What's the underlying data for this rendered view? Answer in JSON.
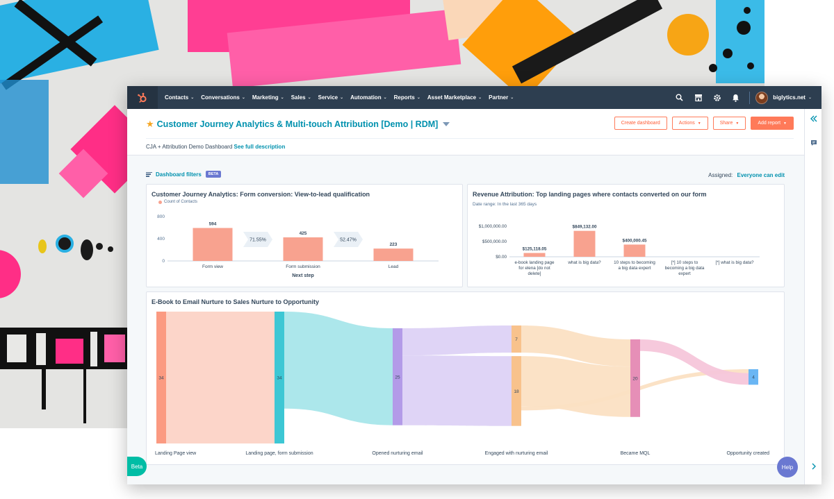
{
  "nav": {
    "items": [
      "Contacts",
      "Conversations",
      "Marketing",
      "Sales",
      "Service",
      "Automation",
      "Reports",
      "Asset Marketplace",
      "Partner"
    ],
    "account": "biglytics.net",
    "icons": [
      "search-icon",
      "marketplace-icon",
      "settings-icon",
      "notifications-icon"
    ]
  },
  "header": {
    "title": "Customer Journey Analytics & Multi-touch Attribution [Demo | RDM]",
    "create_label": "Create dashboard",
    "actions_label": "Actions",
    "share_label": "Share",
    "add_report_label": "Add report",
    "description": "CJA + Attribution Demo Dashboard",
    "see_full": "See full description"
  },
  "filters": {
    "label": "Dashboard filters",
    "badge": "BETA",
    "assigned_label": "Assigned:",
    "assigned_value": "Everyone can edit"
  },
  "report1": {
    "title": "Customer Journey Analytics: Form conversion: View-to-lead qualification",
    "legend": "Count of Contacts",
    "color": "#f8a28f",
    "chart_data": {
      "type": "bar",
      "categories": [
        "Form view",
        "Form submission",
        "Lead"
      ],
      "values": [
        594,
        425,
        223
      ],
      "value_labels": [
        "594",
        "425",
        "223"
      ],
      "conversion_rates": [
        "71.55%",
        "52.47%"
      ],
      "xlabel": "Next step",
      "yticks": [
        "800",
        "400",
        "0"
      ],
      "ylim": [
        0,
        800
      ]
    }
  },
  "report2": {
    "title": "Revenue Attribution: Top landing pages where contacts converted on our form",
    "subtitle": "Date range: In the last 365 days",
    "color": "#f8a28f",
    "chart_data": {
      "type": "bar",
      "categories": [
        [
          "e-book landing page",
          "for elena [do not",
          "delete]"
        ],
        [
          "what is big data?"
        ],
        [
          "10 steps to becoming",
          "a big data expert"
        ],
        [
          "[*] 10 steps to",
          "becoming a big data",
          "expert"
        ],
        [
          "[*] what is big data?"
        ]
      ],
      "values": [
        125118.05,
        849132.0,
        400000.45,
        0,
        0
      ],
      "value_labels": [
        "$125,118.05",
        "$849,132.00",
        "$400,000.45",
        "",
        ""
      ],
      "yticks": [
        "$1,000,000.00",
        "$500,000.00",
        "$0.00"
      ],
      "ylim": [
        0,
        1000000
      ]
    }
  },
  "report3": {
    "title": "E-Book to Email Nurture to Sales Nurture to Opportunity",
    "chart_data": {
      "type": "sankey",
      "stages": [
        {
          "name": "Landing Page view",
          "nodes": [
            {
              "value": 34,
              "label": "34",
              "color": "#fb9a81"
            }
          ]
        },
        {
          "name": "Landing page, form submission",
          "nodes": [
            {
              "value": 34,
              "label": "34",
              "color": "#3dc7d4"
            }
          ]
        },
        {
          "name": "Opened nurturing email",
          "nodes": [
            {
              "value": 25,
              "label": "25",
              "color": "#b39be8"
            }
          ]
        },
        {
          "name": "Engaged with nurturing email",
          "nodes": [
            {
              "value": 7,
              "label": "7",
              "color": "#f8c28c"
            },
            {
              "value": 18,
              "label": "18",
              "color": "#f8c28c"
            }
          ]
        },
        {
          "name": "Became MQL",
          "nodes": [
            {
              "value": 20,
              "label": "20",
              "color": "#e68fb7"
            }
          ]
        },
        {
          "name": "Opportunity created",
          "nodes": [
            {
              "value": 4,
              "label": "4",
              "color": "#6ab6f4"
            }
          ]
        }
      ],
      "links": [
        {
          "from": [
            0,
            0
          ],
          "to": [
            1,
            0
          ],
          "value": 34,
          "color": "#fcd3c6"
        },
        {
          "from": [
            1,
            0
          ],
          "to": [
            2,
            0
          ],
          "value": 25,
          "color": "#a8e6ea"
        },
        {
          "from": [
            2,
            0
          ],
          "to": [
            3,
            0
          ],
          "value": 7,
          "color": "#ddd2f5"
        },
        {
          "from": [
            2,
            0
          ],
          "to": [
            3,
            1
          ],
          "value": 18,
          "color": "#ddd2f5"
        },
        {
          "from": [
            3,
            0
          ],
          "to": [
            4,
            0
          ],
          "value": 7,
          "color": "#fbe0c3"
        },
        {
          "from": [
            3,
            1
          ],
          "to": [
            4,
            0
          ],
          "value": 13,
          "color": "#fbe0c3"
        },
        {
          "from": [
            3,
            1
          ],
          "to": [
            5,
            0
          ],
          "value": 1,
          "color": "#fbe0c3"
        },
        {
          "from": [
            4,
            0
          ],
          "to": [
            5,
            0
          ],
          "value": 3,
          "color": "#f5c6da"
        }
      ]
    }
  },
  "beta_label": "Beta",
  "help_label": "Help"
}
